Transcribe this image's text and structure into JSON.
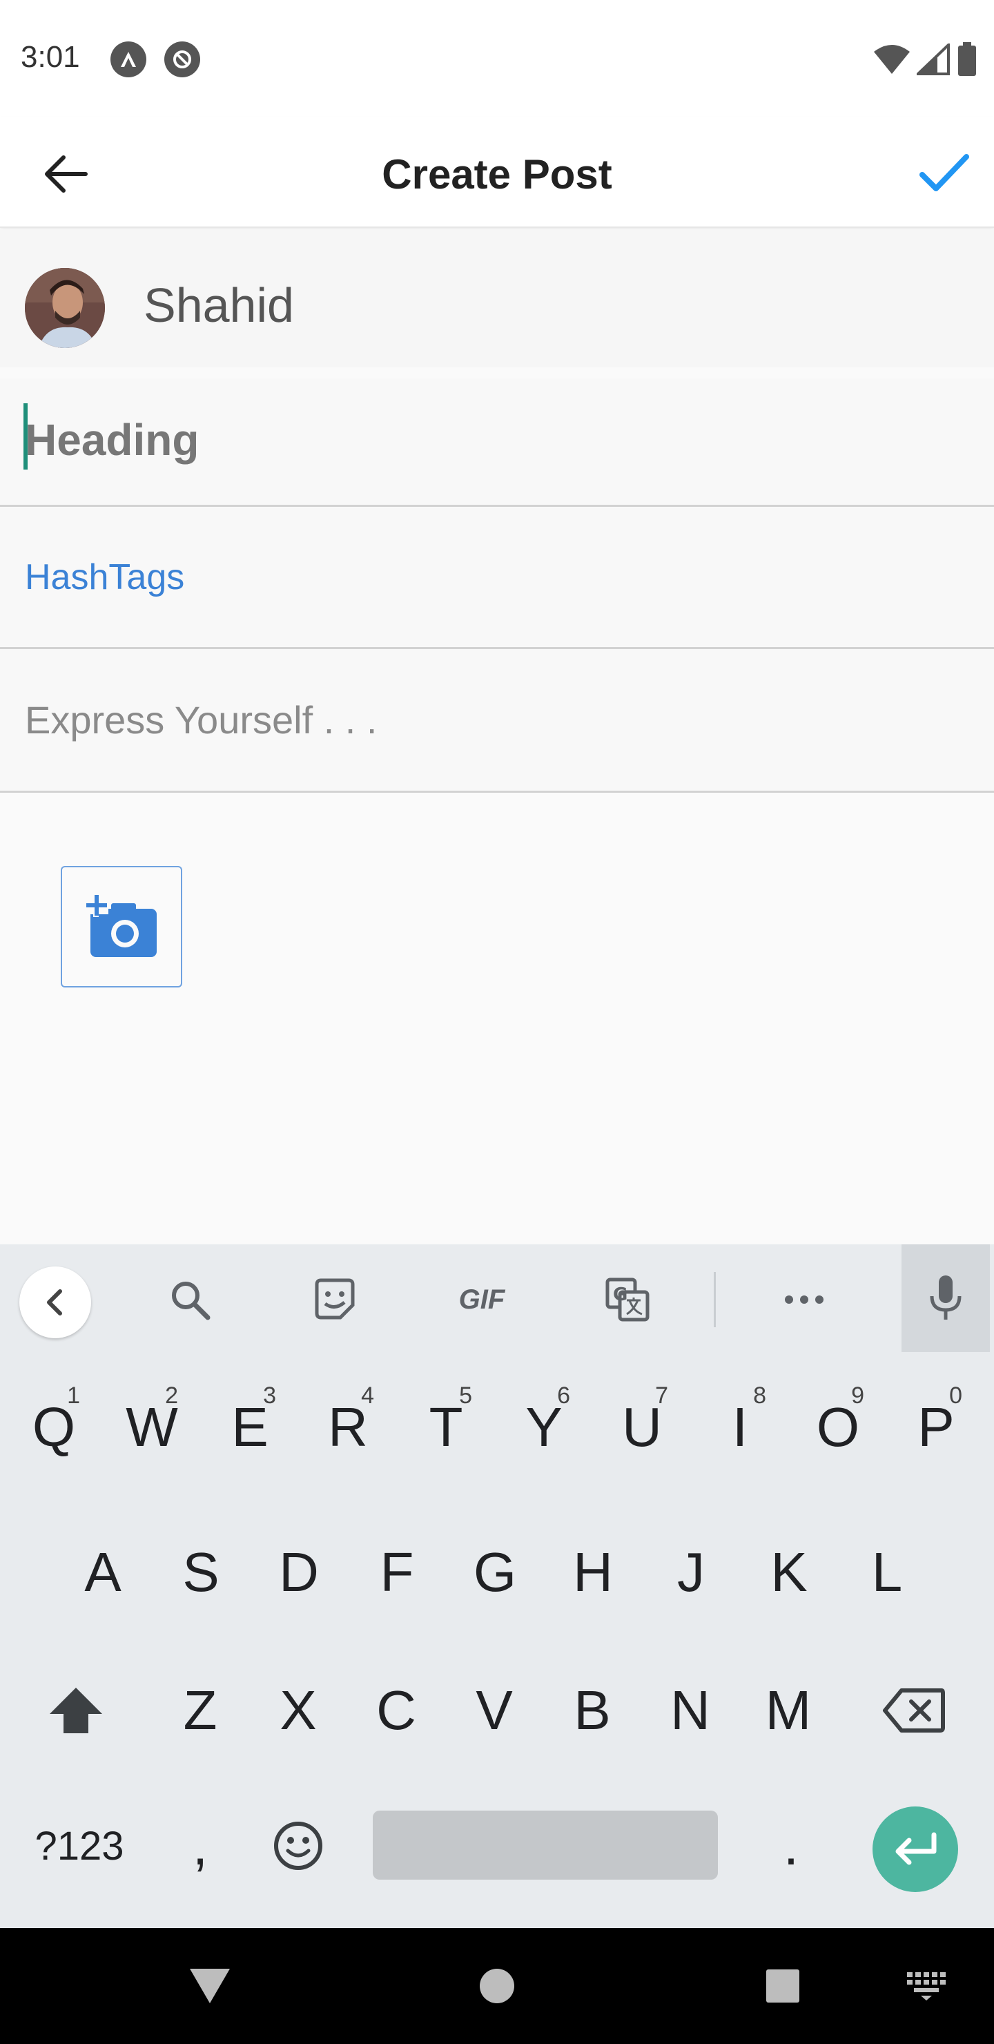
{
  "status_bar": {
    "time": "3:01",
    "icons": [
      "app-notification-icon",
      "do-not-disturb-icon",
      "wifi-icon",
      "cell-signal-icon",
      "battery-icon"
    ]
  },
  "app_bar": {
    "title": "Create Post",
    "back_icon": "arrow-back-icon",
    "confirm_icon": "check-icon",
    "confirm_color": "#2196F3"
  },
  "author": {
    "name": "Shahid"
  },
  "form": {
    "heading_placeholder": "Heading",
    "hashtags_placeholder": "HashTags",
    "body_placeholder": "Express Yourself . . .",
    "add_photo_icon": "add-a-photo-icon",
    "accent_color": "#3b82d6"
  },
  "keyboard": {
    "toolbar": [
      "collapse-icon",
      "search-icon",
      "sticker-icon",
      "GIF",
      "translate-icon",
      "more-icon",
      "mic-icon"
    ],
    "rows": [
      [
        {
          "label": "Q",
          "hint": "1"
        },
        {
          "label": "W",
          "hint": "2"
        },
        {
          "label": "E",
          "hint": "3"
        },
        {
          "label": "R",
          "hint": "4"
        },
        {
          "label": "T",
          "hint": "5"
        },
        {
          "label": "Y",
          "hint": "6"
        },
        {
          "label": "U",
          "hint": "7"
        },
        {
          "label": "I",
          "hint": "8"
        },
        {
          "label": "O",
          "hint": "9"
        },
        {
          "label": "P",
          "hint": "0"
        }
      ],
      [
        "A",
        "S",
        "D",
        "F",
        "G",
        "H",
        "J",
        "K",
        "L"
      ],
      [
        "Z",
        "X",
        "C",
        "V",
        "B",
        "N",
        "M"
      ]
    ],
    "bottom_row": {
      "symbols_label": "?123",
      "comma_label": ",",
      "period_label": "."
    },
    "enter_color": "#4db6a0"
  },
  "nav_bar": {
    "buttons": [
      "back-triangle-icon",
      "home-circle-icon",
      "recents-square-icon",
      "keyboard-switch-icon"
    ]
  }
}
